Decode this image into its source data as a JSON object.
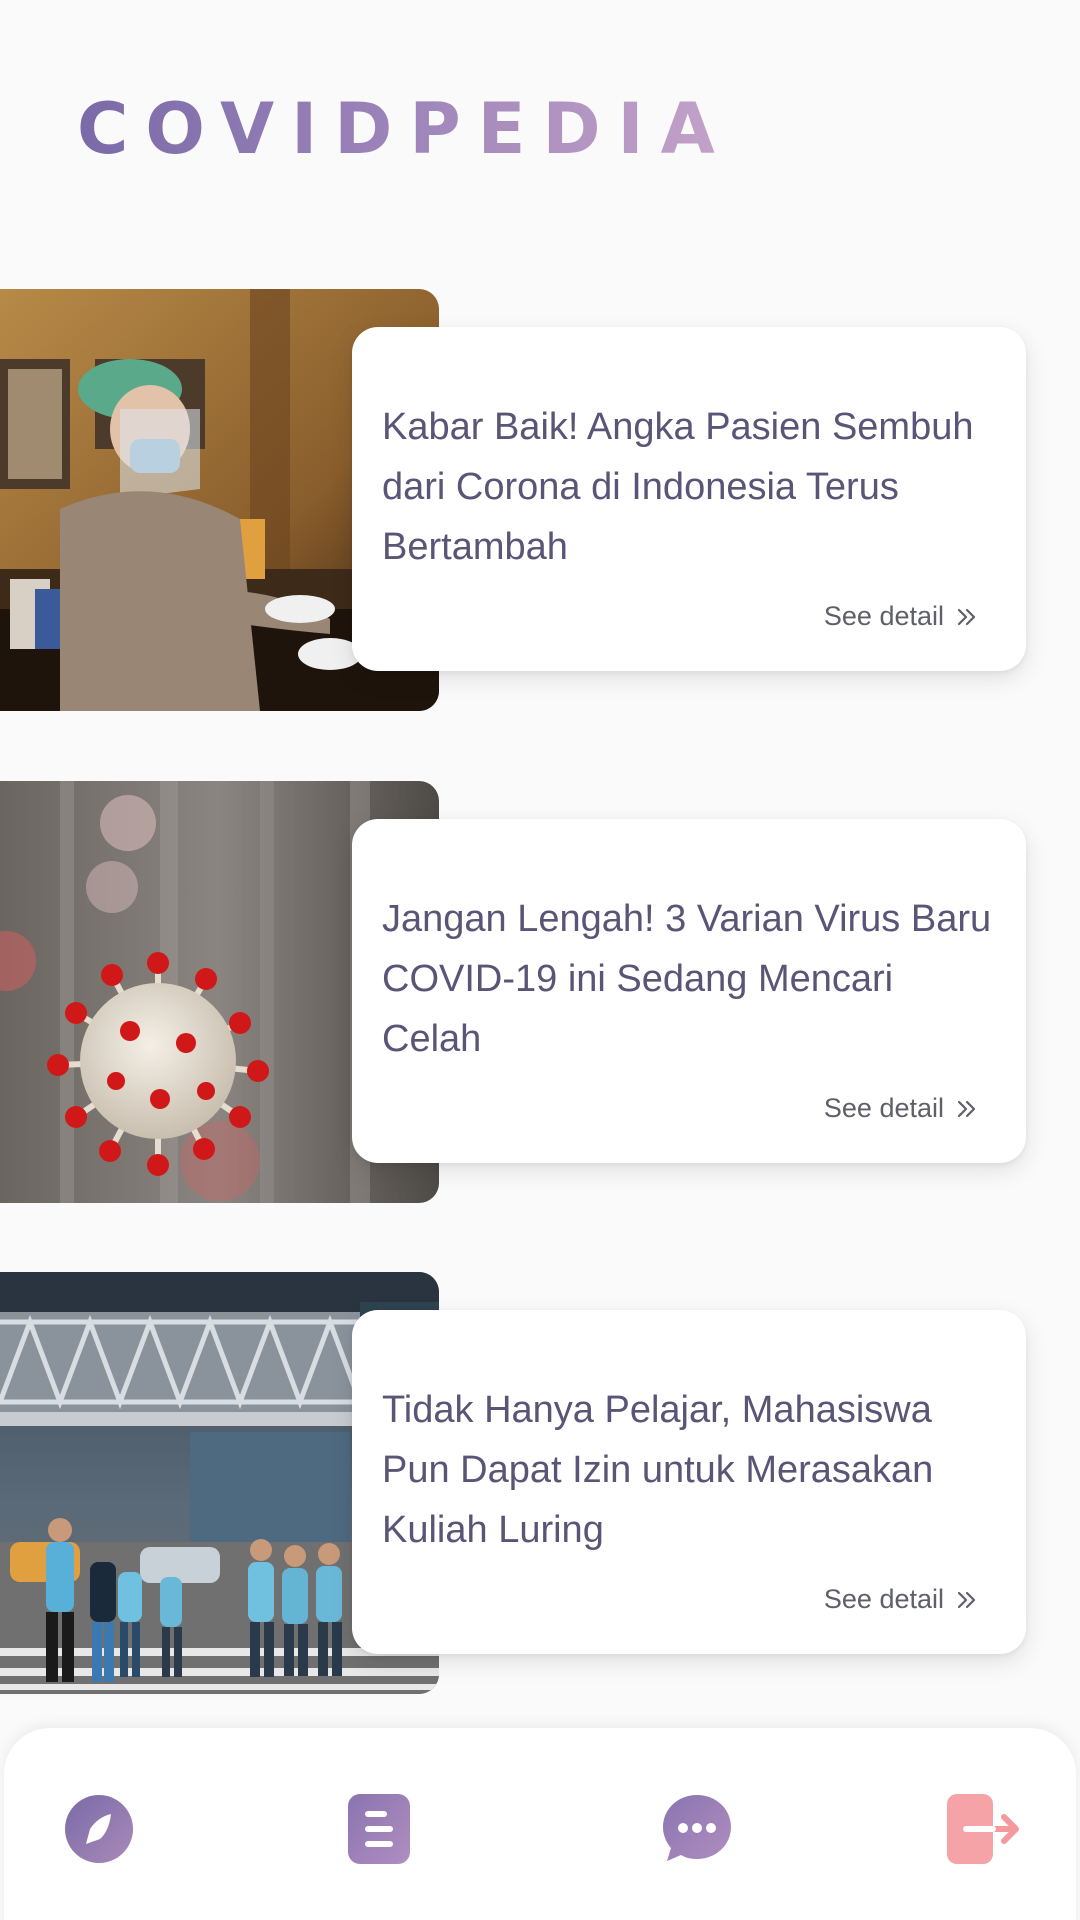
{
  "app": {
    "title": "COVIDPEDIA"
  },
  "colors": {
    "title_gradient_start": "#7a6aa8",
    "title_gradient_end": "#c4a3c9",
    "card_title": "#5a5577",
    "see_detail": "#5f5f6a",
    "nav_icon_purple": "#8f78b0",
    "nav_icon_logout": "#f4a0a3"
  },
  "news": [
    {
      "title": "Kabar Baik! Angka Pasien Sembuh dari Corona di Indonesia Terus Bertambah",
      "see_detail": "See detail",
      "image": "health-worker-with-face-shield-photo"
    },
    {
      "title": "Jangan Lengah! 3 Varian Virus Baru COVID-19 ini Sedang Mencari Celah",
      "see_detail": "See detail",
      "image": "coronavirus-particle-photo"
    },
    {
      "title": "Tidak Hanya Pelajar, Mahasiswa Pun Dapat Izin untuk Merasakan Kuliah Luring",
      "see_detail": "See detail",
      "image": "students-crossing-street-photo"
    }
  ],
  "bottom_nav": [
    {
      "icon": "compass-icon"
    },
    {
      "icon": "article-icon"
    },
    {
      "icon": "chat-icon"
    },
    {
      "icon": "logout-icon"
    }
  ]
}
